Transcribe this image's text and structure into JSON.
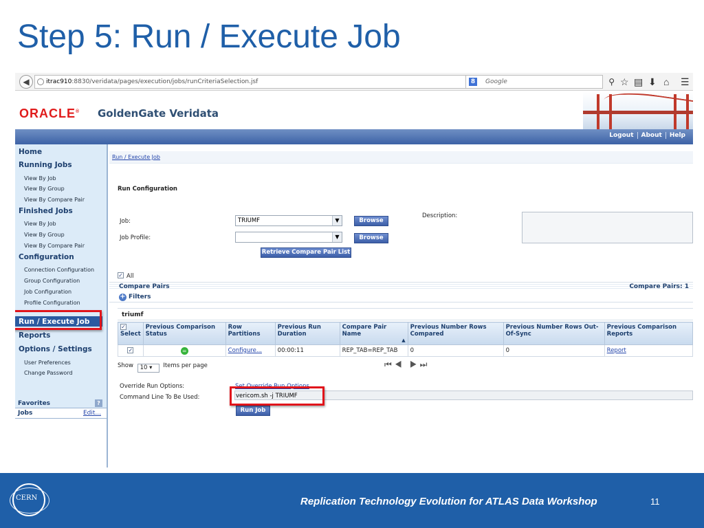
{
  "slide": {
    "title": "Step 5: Run / Execute Job",
    "footer": "Replication Technology Evolution for ATLAS Data Workshop",
    "page_number": "11",
    "logo_text": "CERN"
  },
  "browser": {
    "url_host": "itrac910",
    "url_rest": ":8830/veridata/pages/execution/jobs/runCriteriaSelection.jsf",
    "url_controls": "▽ C",
    "search_engine_glyph": "8",
    "search_placeholder": "Google"
  },
  "app": {
    "brand": "ORACLE",
    "brand_mark": "®",
    "product": "GoldenGate Veridata",
    "top_links": [
      "Logout",
      "About",
      "Help"
    ]
  },
  "sidebar": {
    "home": "Home",
    "running_jobs": {
      "title": "Running Jobs",
      "items": [
        "View By Job",
        "View By Group",
        "View By Compare Pair"
      ]
    },
    "finished_jobs": {
      "title": "Finished Jobs",
      "items": [
        "View By Job",
        "View By Group",
        "View By Compare Pair"
      ]
    },
    "configuration": {
      "title": "Configuration",
      "items": [
        "Connection Configuration",
        "Group Configuration",
        "Job Configuration",
        "Profile Configuration"
      ]
    },
    "run_execute": "Run / Execute Job",
    "reports": "Reports",
    "options": {
      "title": "Options / Settings",
      "items": [
        "User Preferences",
        "Change Password"
      ]
    },
    "favorites": "Favorites",
    "favorites_help": "?",
    "jobs": "Jobs",
    "jobs_edit": "Edit..."
  },
  "content": {
    "breadcrumb": "Run / Execute Job",
    "run_config": "Run Configuration",
    "job_label": "Job:",
    "job_value": "TRIUMF",
    "job_profile_label": "Job Profile:",
    "job_profile_value": "",
    "browse": "Browse",
    "retrieve": "Retrieve Compare Pair List",
    "description_label": "Description:",
    "all_label": "All",
    "compare_pairs": "Compare Pairs",
    "compare_pairs_count": "Compare Pairs: 1",
    "filters": "Filters",
    "group": "triumf",
    "table": {
      "headers": [
        "Select",
        "Previous Comparison Status",
        "Row Partitions",
        "Previous Run Duration",
        "Compare Pair Name",
        "Previous Number Rows Compared",
        "Previous Number Rows Out-Of-Sync",
        "Previous Comparison Reports"
      ],
      "sort_indicator": "▲",
      "row": {
        "status_icon": "status-ok-icon",
        "partitions": "Configure...",
        "duration": "00:00:11",
        "name": "REP_TAB=REP_TAB",
        "compared": "0",
        "out_of_sync": "0",
        "report": "Report"
      }
    },
    "show_label": "Show",
    "page_size": "10",
    "items_per_page": "Items per page",
    "override_label": "Override Run Options:",
    "override_link": "Set Override Run Options",
    "command_label": "Command Line To Be Used:",
    "command_value": "vericom.sh -j TRIUMF",
    "run_job": "Run Job"
  },
  "colors": {
    "title_blue": "#1f5fa8",
    "oracle_red": "#e01b1b",
    "highlight_red": "#e1141b",
    "nav_blue": "#2b5aa0"
  }
}
